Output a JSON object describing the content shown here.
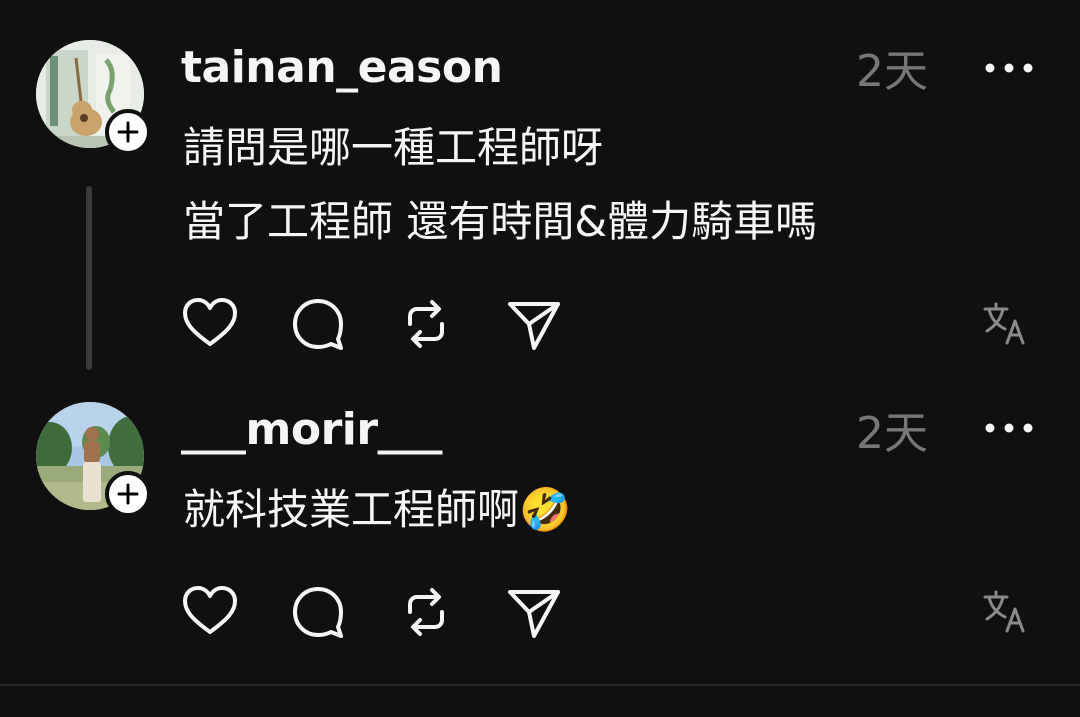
{
  "comments": [
    {
      "username": "tainan_eason",
      "time": "2天",
      "lines": [
        "請問是哪一種工程師呀",
        "當了工程師 還有時間&體力騎車嗎"
      ],
      "avatar_desc": "guitar-photo"
    },
    {
      "username": "___morir___",
      "time": "2天",
      "lines": [
        "就科技業工程師啊🤣"
      ],
      "avatar_desc": "person-outdoor-photo"
    }
  ],
  "colors": {
    "background": "#101010",
    "text_primary": "#f3f5f7",
    "text_secondary": "#777777",
    "thread_line": "#3a3a3a"
  },
  "icons": [
    "like-icon",
    "comment-icon",
    "repost-icon",
    "share-icon",
    "translate-icon",
    "more-options-icon",
    "follow-plus-icon"
  ]
}
